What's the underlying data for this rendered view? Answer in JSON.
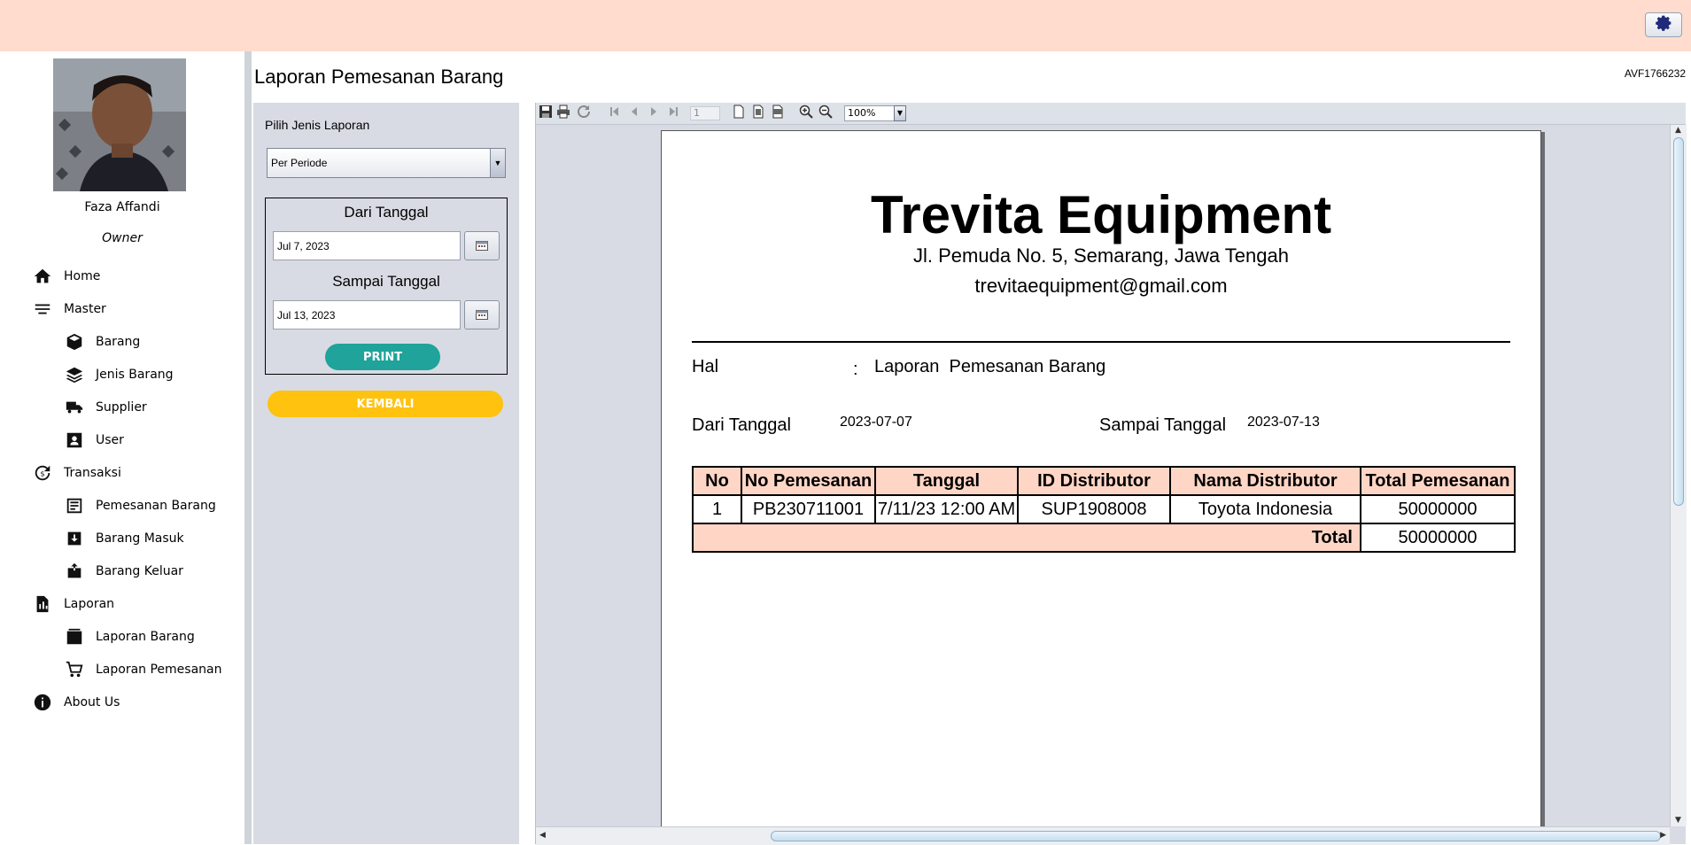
{
  "header": {
    "settings_icon": "gear-icon",
    "accent": "#ffdccd"
  },
  "user": {
    "name": "Faza Affandi",
    "role": "Owner"
  },
  "sidebar": {
    "items": [
      {
        "label": "Home",
        "icon": "home-icon"
      },
      {
        "label": "Master",
        "icon": "list-icon"
      },
      {
        "label": "Barang",
        "icon": "box-icon"
      },
      {
        "label": "Jenis Barang",
        "icon": "layers-icon"
      },
      {
        "label": "Supplier",
        "icon": "truck-icon"
      },
      {
        "label": "User",
        "icon": "user-card-icon"
      },
      {
        "label": "Transaksi",
        "icon": "exchange-icon"
      },
      {
        "label": "Pemesanan Barang",
        "icon": "order-list-icon"
      },
      {
        "label": "Barang Masuk",
        "icon": "inbox-in-icon"
      },
      {
        "label": "Barang Keluar",
        "icon": "inbox-out-icon"
      },
      {
        "label": "Laporan",
        "icon": "report-icon"
      },
      {
        "label": "Laporan Barang",
        "icon": "report-box-icon"
      },
      {
        "label": "Laporan Pemesanan",
        "icon": "cart-icon"
      },
      {
        "label": "About Us",
        "icon": "info-icon"
      }
    ]
  },
  "main": {
    "title": "Laporan Pemesanan Barang",
    "code": "AVF1766232"
  },
  "filter": {
    "label": "Pilih Jenis Laporan",
    "report_type": "Per Periode",
    "from_title": "Dari Tanggal",
    "from_value": "Jul 7, 2023",
    "to_title": "Sampai Tanggal",
    "to_value": "Jul 13, 2023",
    "print_label": "PRINT",
    "back_label": "KEMBALI",
    "print_color": "#1fa39a",
    "back_color": "#ffc20e"
  },
  "viewer": {
    "page_number": "1",
    "zoom": "100%"
  },
  "report": {
    "company": "Trevita Equipment",
    "address": "Jl. Pemuda No. 5, Semarang, Jawa Tengah",
    "email": "trevitaequipment@gmail.com",
    "hal_label": "Hal",
    "hal_colon": ":",
    "hal_value": "Laporan  Pemesanan Barang",
    "from_label": "Dari Tanggal",
    "from_value": "2023-07-07",
    "to_label": "Sampai Tanggal",
    "to_value": "2023-07-13",
    "columns": [
      "No",
      "No Pemesanan",
      "Tanggal",
      "ID Distributor",
      "Nama Distributor",
      "Total Pemesanan"
    ],
    "rows": [
      [
        "1",
        "PB230711001",
        "7/11/23 12:00 AM",
        "SUP1908008",
        "Toyota Indonesia",
        "50000000"
      ]
    ],
    "total_label": "Total",
    "total_value": "50000000",
    "header_color": "#ffd6c6"
  }
}
